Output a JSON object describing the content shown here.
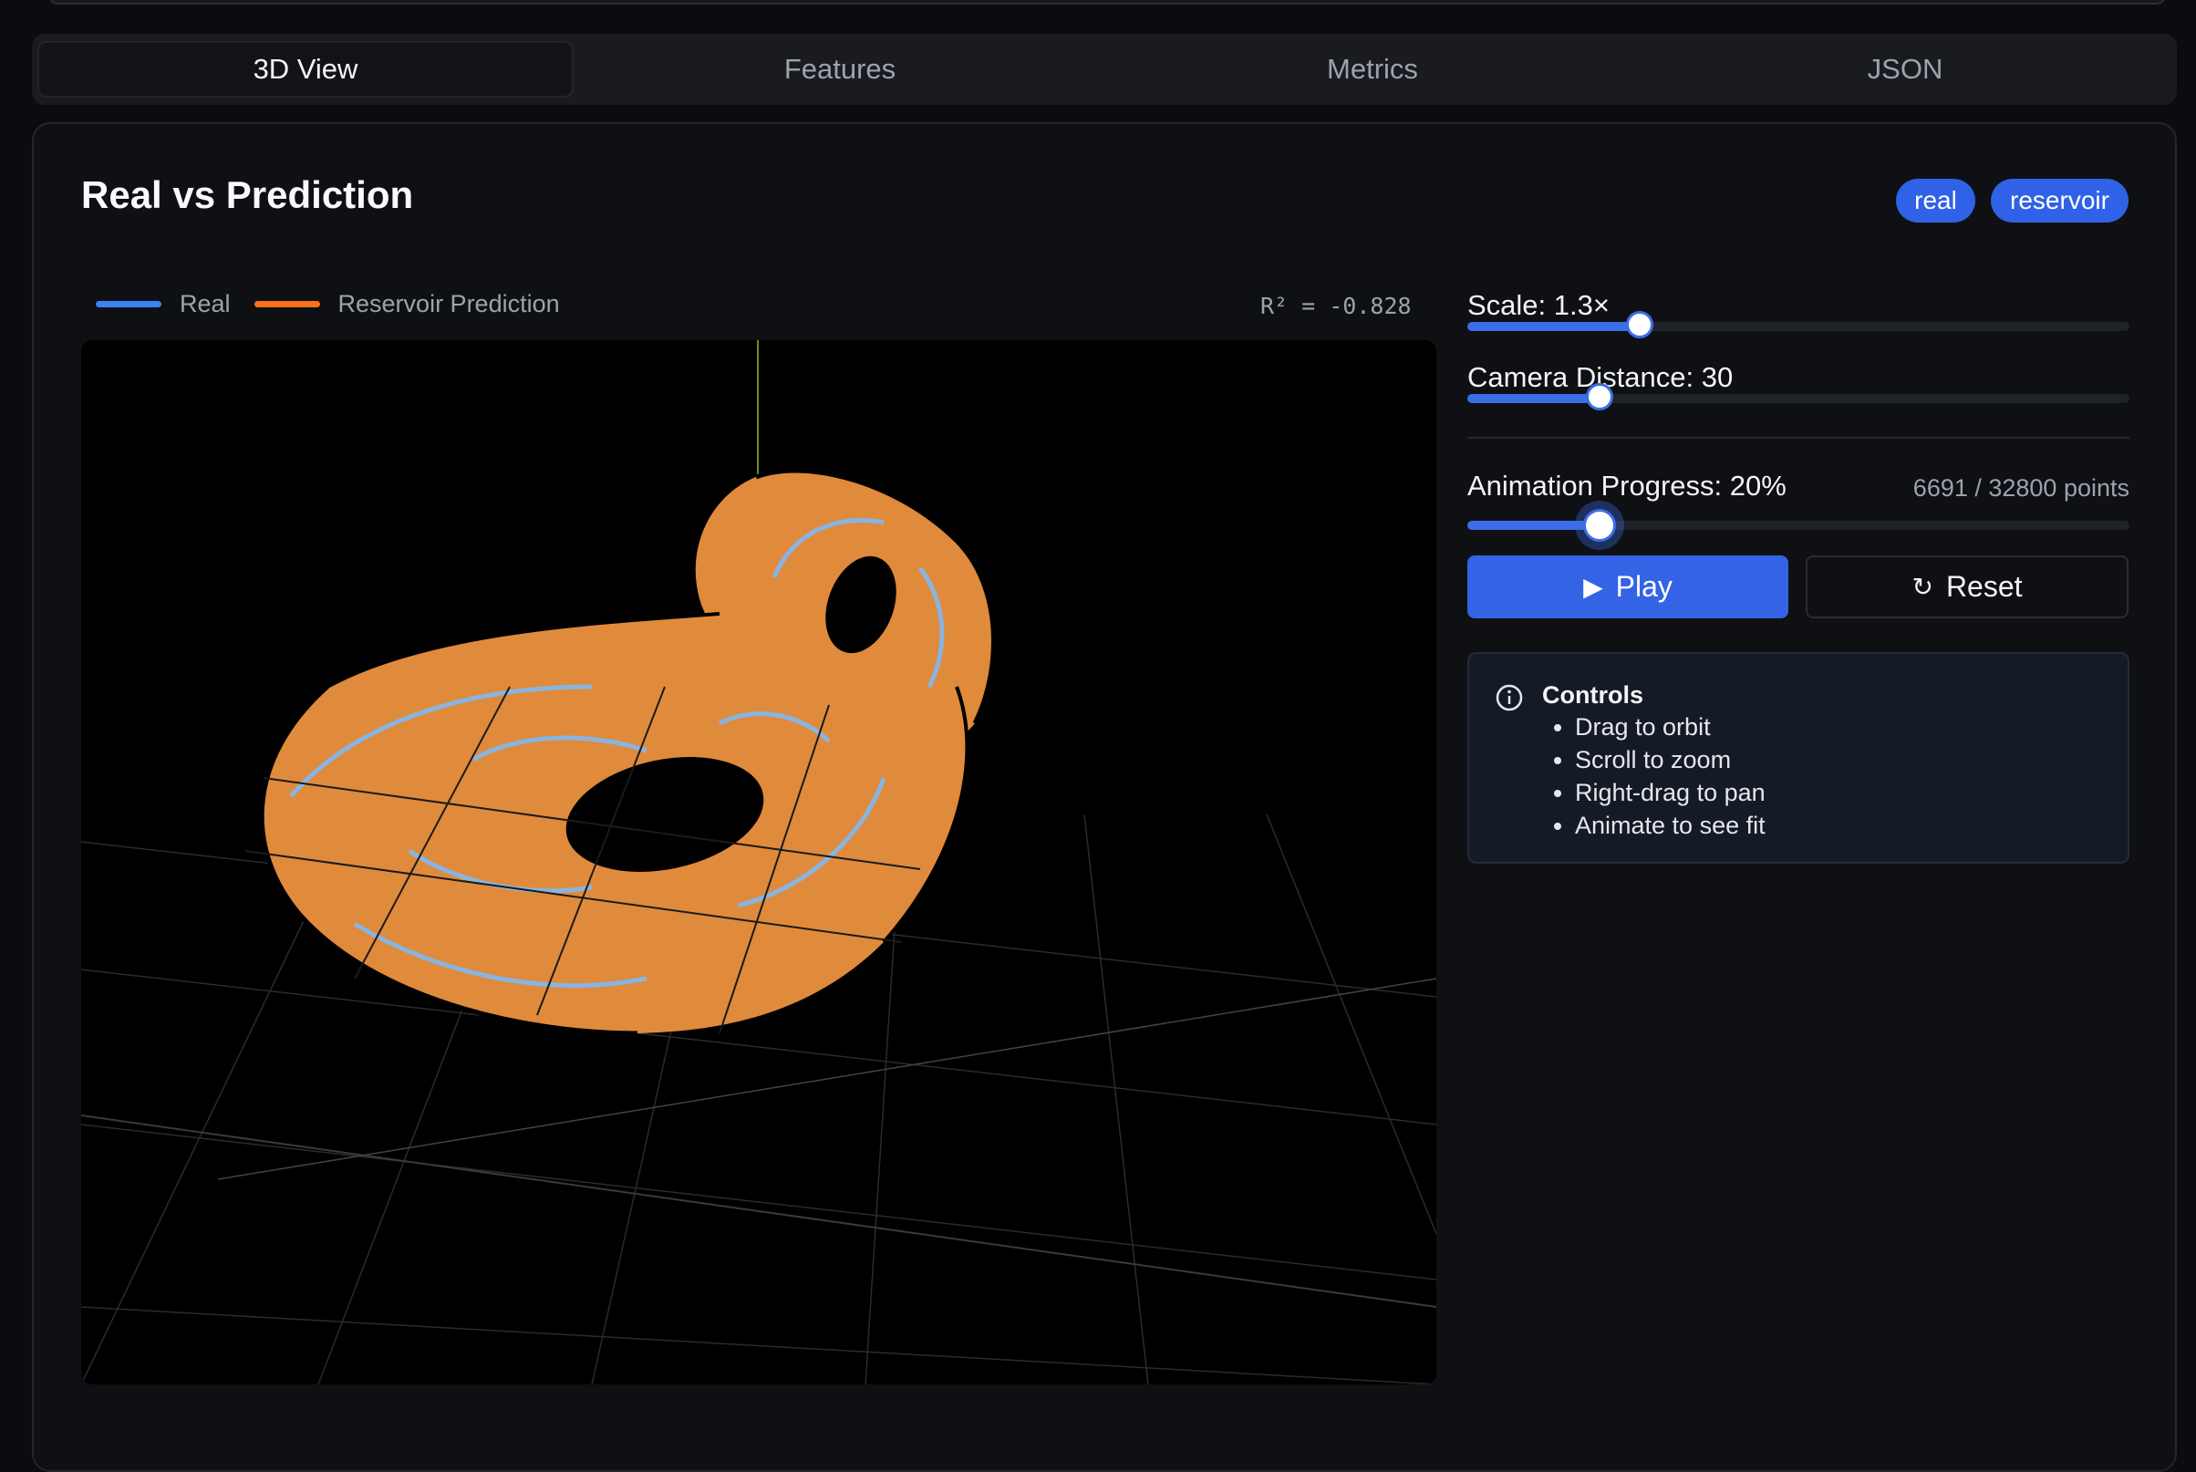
{
  "tabs": [
    {
      "label": "3D View",
      "active": true
    },
    {
      "label": "Features",
      "active": false
    },
    {
      "label": "Metrics",
      "active": false
    },
    {
      "label": "JSON",
      "active": false
    }
  ],
  "card": {
    "title": "Real vs Prediction",
    "badges": [
      "real",
      "reservoir"
    ]
  },
  "legend": {
    "real": {
      "label": "Real",
      "color": "#3b82f6"
    },
    "prediction": {
      "label": "Reservoir Prediction",
      "color": "#f97316"
    }
  },
  "r2_text": "R² = -0.828",
  "controls": {
    "scale": {
      "label": "Scale: 1.3×",
      "fraction": 0.26
    },
    "camera": {
      "label": "Camera Distance: 30",
      "fraction": 0.2
    },
    "progress": {
      "label": "Animation Progress: 20%",
      "fraction": 0.2,
      "points_text": "6691 / 32800 points"
    },
    "play_label": "Play",
    "reset_label": "Reset"
  },
  "info": {
    "title": "Controls",
    "items": [
      "Drag to orbit",
      "Scroll to zoom",
      "Right-drag to pan",
      "Animate to see fit"
    ]
  },
  "colors": {
    "accent": "#3563e6",
    "prediction_render": "#e08a3c",
    "real_render": "#8ab4e0"
  }
}
